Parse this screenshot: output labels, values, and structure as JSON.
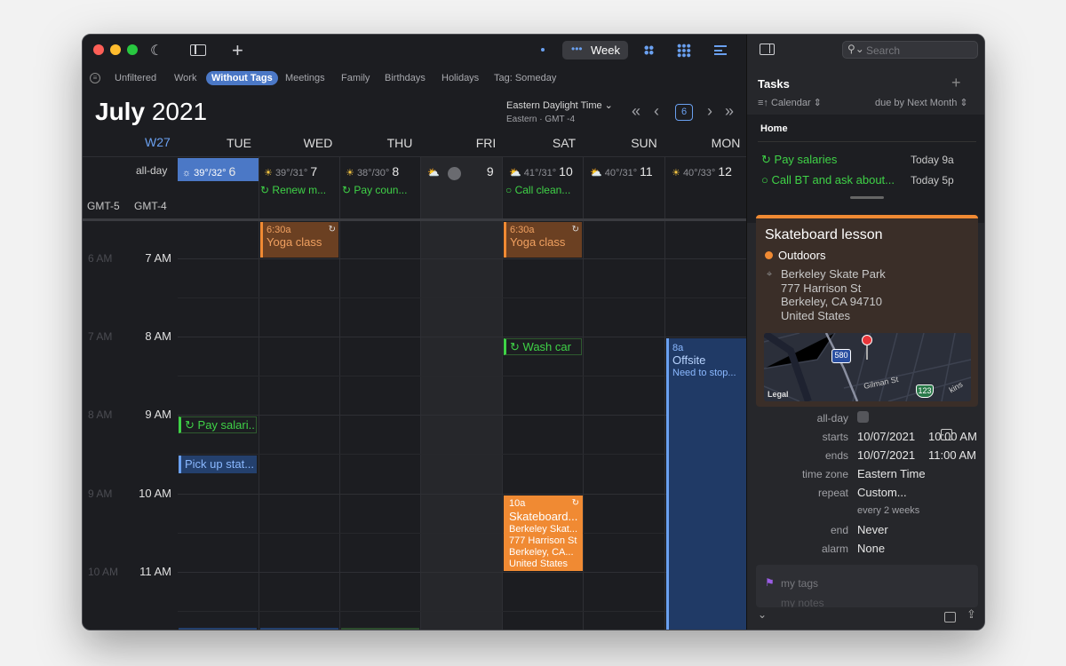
{
  "toolbar": {
    "view_week": "Week",
    "search_placeholder": "Search"
  },
  "filters": [
    "Unfiltered",
    "Work",
    "Without Tags",
    "Meetings",
    "Family",
    "Birthdays",
    "Holidays",
    "Tag: Someday"
  ],
  "header": {
    "month": "July",
    "year": "2021",
    "timezone": "Eastern Daylight Time",
    "tz_sub": "Eastern · GMT -4",
    "today": "6",
    "week": "W27"
  },
  "days": [
    {
      "name": "TUE",
      "num": "6",
      "hi": "39°/32°"
    },
    {
      "name": "WED",
      "num": "7",
      "hi": "39°/31°"
    },
    {
      "name": "THU",
      "num": "8",
      "hi": "38°/30°"
    },
    {
      "name": "FRI",
      "num": "9",
      "hi": ""
    },
    {
      "name": "SAT",
      "num": "10",
      "hi": "41°/31°"
    },
    {
      "name": "SUN",
      "num": "11",
      "hi": "40°/31°"
    },
    {
      "name": "MON",
      "num": "12",
      "hi": "40°/33°"
    }
  ],
  "allday": {
    "label": "all-day",
    "tz1": "GMT-5",
    "tz2": "GMT-4",
    "e1": "Renew m...",
    "e2": "Pay coun...",
    "e3": "Call clean..."
  },
  "hours": [
    {
      "a": "6 AM",
      "b": "7 AM"
    },
    {
      "a": "7 AM",
      "b": "8 AM"
    },
    {
      "a": "8 AM",
      "b": "9 AM"
    },
    {
      "a": "9 AM",
      "b": "10 AM"
    },
    {
      "a": "10 AM",
      "b": "11 AM"
    }
  ],
  "events": {
    "yoga_time": "6:30a",
    "yoga": "Yoga class",
    "wash": "Wash car",
    "pay": "Pay salari...",
    "pick": "Pick up stat...",
    "offsite_time": "8a",
    "offsite": "Offsite",
    "offsite_note": "Need to stop...",
    "skate_time": "10a",
    "skate": "Skateboard...",
    "skate_l1": "Berkeley Skat...",
    "skate_l2": "777 Harrison St",
    "skate_l3": "Berkeley, CA...",
    "skate_l4": "United States"
  },
  "tasks": {
    "title": "Tasks",
    "source": "Calendar",
    "sort": "due by Next Month",
    "group": "Home",
    "items": [
      {
        "name": "Pay salaries",
        "due": "Today 9a"
      },
      {
        "name": "Call BT and ask about...",
        "due": "Today 5p"
      }
    ]
  },
  "detail": {
    "title": "Skateboard lesson",
    "calendar": "Outdoors",
    "loc1": "Berkeley Skate Park",
    "loc2": "777 Harrison St",
    "loc3": "Berkeley, CA  94710",
    "loc4": "United States",
    "map_legal": "Legal",
    "map_road": "Gilman St",
    "map_shield1": "580",
    "map_shield2": "123",
    "map_tail": "kins",
    "allday": "all-day",
    "starts": "starts",
    "start_date": "10/07/2021",
    "start_time": "10:00 AM",
    "ends": "ends",
    "end_date": "10/07/2021",
    "end_time": "11:00 AM",
    "tz_label": "time zone",
    "tz": "Eastern Time",
    "repeat_label": "repeat",
    "repeat": "Custom...",
    "every": "every 2 weeks",
    "end_label": "end",
    "end": "Never",
    "alarm_label": "alarm",
    "alarm": "None",
    "tags": "my tags",
    "notes": "my notes"
  },
  "colors": {
    "accent": "#4b78c6",
    "green": "#3fd247",
    "orange": "#f08a33",
    "blue": "#6aa0f0"
  }
}
